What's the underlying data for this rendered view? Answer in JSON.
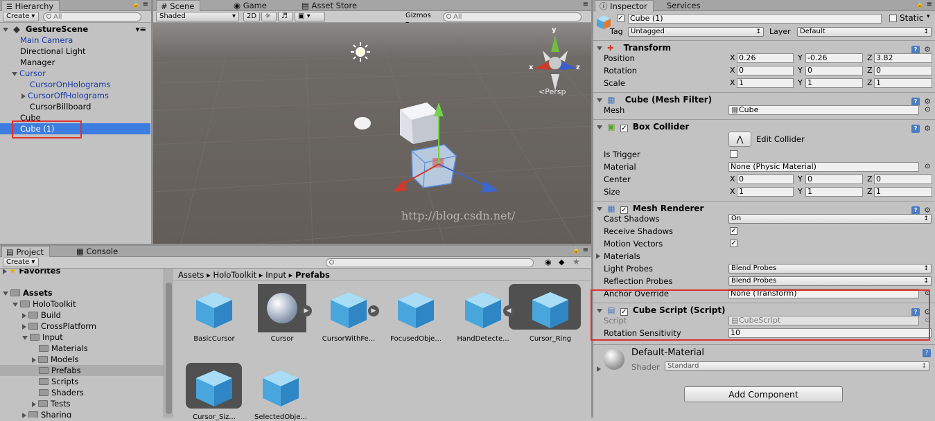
{
  "hierarchy": {
    "tab": "Hierarchy",
    "create": "Create",
    "search_placeholder": "All",
    "scene_name": "GestureScene",
    "items": [
      {
        "label": "Main Camera"
      },
      {
        "label": "Directional Light"
      },
      {
        "label": "Manager"
      },
      {
        "label": "Cursor"
      },
      {
        "label": "CursorOnHolograms"
      },
      {
        "label": "CursorOffHolograms"
      },
      {
        "label": "CursorBillboard"
      },
      {
        "label": "Cube"
      },
      {
        "label": "Cube (1)"
      }
    ]
  },
  "scene": {
    "tabs": [
      "Scene",
      "Game",
      "Asset Store"
    ],
    "shading": "Shaded",
    "mode_2d": "2D",
    "gizmos": "Gizmos",
    "search_placeholder": "All",
    "persp": "Persp",
    "axis_x": "x",
    "axis_y": "y",
    "axis_z": "z",
    "watermark": "http://blog.csdn.net/"
  },
  "project": {
    "tabs": [
      "Project",
      "Console"
    ],
    "create": "Create",
    "favorites": "Favorites",
    "tree": [
      {
        "label": "Assets"
      },
      {
        "label": "HoloToolkit"
      },
      {
        "label": "Build"
      },
      {
        "label": "CrossPlatform"
      },
      {
        "label": "Input"
      },
      {
        "label": "Materials"
      },
      {
        "label": "Models"
      },
      {
        "label": "Prefabs"
      },
      {
        "label": "Scripts"
      },
      {
        "label": "Shaders"
      },
      {
        "label": "Tests"
      },
      {
        "label": "Sharing"
      }
    ],
    "breadcrumb": [
      "Assets",
      "HoloToolkit",
      "Input",
      "Prefabs"
    ],
    "assets": [
      {
        "label": "BasicCursor"
      },
      {
        "label": "Cursor"
      },
      {
        "label": "CursorWithFe..."
      },
      {
        "label": "FocusedObje..."
      },
      {
        "label": "HandDetecte..."
      },
      {
        "label": "Cursor_Ring"
      },
      {
        "label": "Cursor_Siz..."
      },
      {
        "label": "SelectedObje..."
      }
    ]
  },
  "inspector": {
    "tabs": [
      "Inspector",
      "Services"
    ],
    "object_name": "Cube (1)",
    "static_label": "Static",
    "tag_label": "Tag",
    "tag_value": "Untagged",
    "layer_label": "Layer",
    "layer_value": "Default",
    "transform": {
      "title": "Transform",
      "position_label": "Position",
      "rotation_label": "Rotation",
      "scale_label": "Scale",
      "position": [
        "0.26",
        "-0.26",
        "3.82"
      ],
      "rotation": [
        "0",
        "0",
        "0"
      ],
      "scale": [
        "1",
        "1",
        "1"
      ]
    },
    "axes": [
      "X",
      "Y",
      "Z"
    ],
    "mesh_filter": {
      "title": "Cube (Mesh Filter)",
      "mesh_label": "Mesh",
      "mesh_value": "Cube"
    },
    "box_collider": {
      "title": "Box Collider",
      "edit_label": "Edit Collider",
      "trigger_label": "Is Trigger",
      "material_label": "Material",
      "material_value": "None (Physic Material)",
      "center_label": "Center",
      "size_label": "Size",
      "center": [
        "0",
        "0",
        "0"
      ],
      "size": [
        "1",
        "1",
        "1"
      ]
    },
    "mesh_renderer": {
      "title": "Mesh Renderer",
      "cast_label": "Cast Shadows",
      "cast_value": "On",
      "receive_label": "Receive Shadows",
      "motion_label": "Motion Vectors",
      "materials_label": "Materials",
      "light_label": "Light Probes",
      "light_value": "Blend Probes",
      "reflection_label": "Reflection Probes",
      "reflection_value": "Blend Probes",
      "anchor_label": "Anchor Override",
      "anchor_value": "None (Transform)"
    },
    "cube_script": {
      "title": "Cube Script (Script)",
      "script_label": "Script",
      "script_value": "CubeScript",
      "rotation_label": "Rotation Sensitivity",
      "rotation_value": "10"
    },
    "material": {
      "name": "Default-Material",
      "shader_label": "Shader",
      "shader_value": "Standard"
    },
    "add_component": "Add Component"
  }
}
